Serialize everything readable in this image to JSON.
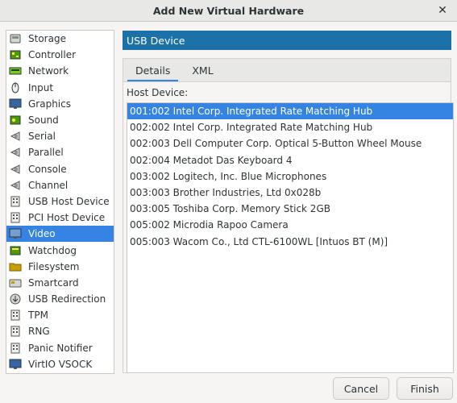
{
  "window": {
    "title": "Add New Virtual Hardware",
    "close_glyph": "✕"
  },
  "sidebar": {
    "selected_index": 12,
    "items": [
      {
        "label": "Storage",
        "icon": "storage-icon"
      },
      {
        "label": "Controller",
        "icon": "controller-icon"
      },
      {
        "label": "Network",
        "icon": "network-icon"
      },
      {
        "label": "Input",
        "icon": "mouse-icon"
      },
      {
        "label": "Graphics",
        "icon": "display-icon"
      },
      {
        "label": "Sound",
        "icon": "sound-icon"
      },
      {
        "label": "Serial",
        "icon": "serial-icon"
      },
      {
        "label": "Parallel",
        "icon": "parallel-icon"
      },
      {
        "label": "Console",
        "icon": "console-icon"
      },
      {
        "label": "Channel",
        "icon": "channel-icon"
      },
      {
        "label": "USB Host Device",
        "icon": "usb-host-icon"
      },
      {
        "label": "PCI Host Device",
        "icon": "pci-host-icon"
      },
      {
        "label": "Video",
        "icon": "video-icon"
      },
      {
        "label": "Watchdog",
        "icon": "watchdog-icon"
      },
      {
        "label": "Filesystem",
        "icon": "folder-icon"
      },
      {
        "label": "Smartcard",
        "icon": "smartcard-icon"
      },
      {
        "label": "USB Redirection",
        "icon": "usb-redirection-icon"
      },
      {
        "label": "TPM",
        "icon": "tpm-icon"
      },
      {
        "label": "RNG",
        "icon": "rng-icon"
      },
      {
        "label": "Panic Notifier",
        "icon": "panic-notifier-icon"
      },
      {
        "label": "VirtIO VSOCK",
        "icon": "vsock-icon"
      }
    ]
  },
  "main": {
    "header": "USB Device",
    "tabs": [
      {
        "label": "Details"
      },
      {
        "label": "XML"
      }
    ],
    "active_tab": 0,
    "host_device_label": "Host Device:",
    "devices": [
      "001:002 Intel Corp. Integrated Rate Matching Hub",
      "002:002 Intel Corp. Integrated Rate Matching Hub",
      "002:003 Dell Computer Corp. Optical 5-Button Wheel Mouse",
      "002:004 Metadot Das Keyboard 4",
      "003:002 Logitech, Inc. Blue Microphones",
      "003:003 Brother Industries, Ltd 0x028b",
      "003:005 Toshiba Corp. Memory Stick 2GB",
      "005:002 Microdia Rapoo Camera",
      "005:003 Wacom Co., Ltd CTL-6100WL [Intuos BT (M)]"
    ],
    "selected_device": 0
  },
  "buttons": {
    "cancel": "Cancel",
    "finish": "Finish"
  },
  "colors": {
    "accent": "#3584e4",
    "header": "#1c72a8"
  }
}
